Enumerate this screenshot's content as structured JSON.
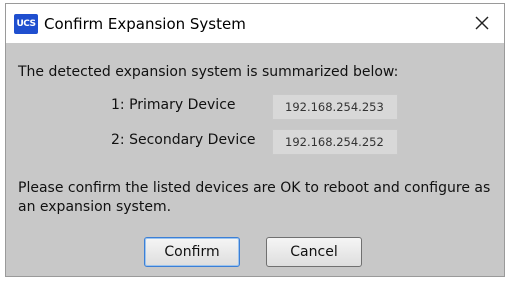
{
  "window": {
    "app_icon_text": "UCS",
    "title": "Confirm Expansion System",
    "close_icon": "close-x-icon"
  },
  "content": {
    "summary": "The detected expansion system is summarized below:",
    "devices": [
      {
        "label": "1: Primary Device",
        "value": "192.168.254.253"
      },
      {
        "label": "2: Secondary Device",
        "value": "192.168.254.252"
      }
    ],
    "message": "Please confirm the listed devices are OK to reboot and configure as an expansion system."
  },
  "buttons": {
    "confirm_label": "Confirm",
    "cancel_label": "Cancel"
  },
  "colors": {
    "dialog_background": "#c8c8c8",
    "default_button_border": "#3c7fd6"
  }
}
